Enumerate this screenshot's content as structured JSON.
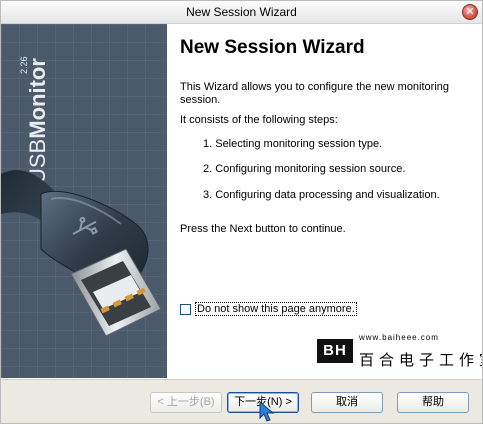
{
  "window": {
    "title": "New Session Wizard"
  },
  "sidebar": {
    "brand": "USBMonitor",
    "brand_prefix": "USB",
    "brand_suffix": "Monitor",
    "version": "2.26"
  },
  "content": {
    "heading": "New Session Wizard",
    "intro": "This Wizard allows you to configure the new monitoring session.",
    "steps_intro": "It consists of the following steps:",
    "steps": [
      "1. Selecting monitoring session type.",
      "2. Configuring monitoring session source.",
      "3. Configuring data processing and visualization."
    ],
    "continue_text": "Press the Next button to continue.",
    "checkbox_label": "Do not show this page anymore.",
    "checkbox_checked": false
  },
  "watermark": {
    "logo": "BH",
    "url": "www.baiheee.com",
    "text": "百合电子工作室"
  },
  "buttons": {
    "back": "< 上一步(B)",
    "next": "下一步(N) >",
    "cancel": "取消",
    "help": "帮助"
  }
}
